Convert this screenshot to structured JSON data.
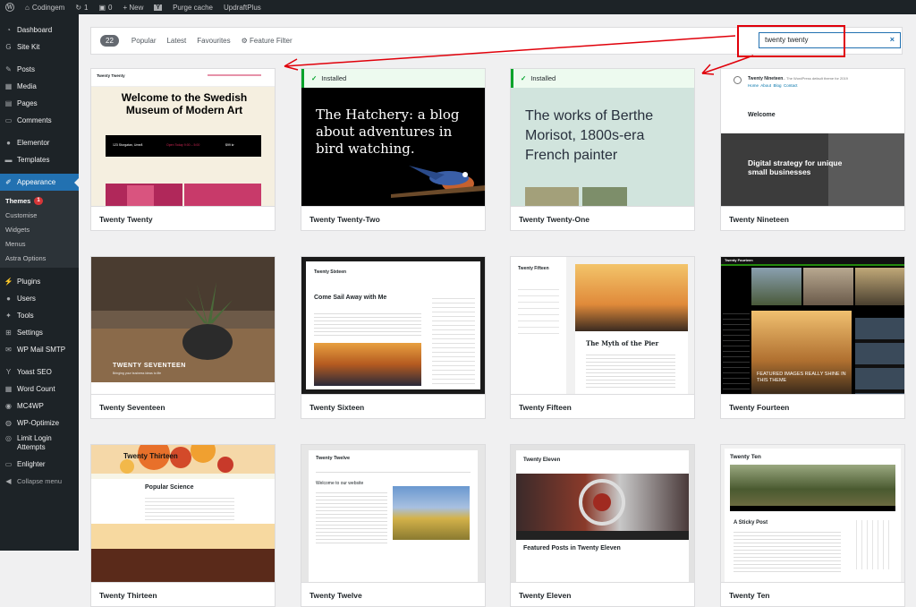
{
  "adminbar": {
    "site": "Codingem",
    "updates": "1",
    "comments": "0",
    "new": "+ New",
    "purge": "Purge cache",
    "updraft": "UpdraftPlus"
  },
  "sidebar": {
    "items": [
      {
        "label": "Dashboard",
        "icon": "gauge-icon"
      },
      {
        "label": "Site Kit",
        "icon": "sitekit-icon"
      },
      {
        "label": "Posts",
        "icon": "pin-icon"
      },
      {
        "label": "Media",
        "icon": "media-icon"
      },
      {
        "label": "Pages",
        "icon": "page-icon"
      },
      {
        "label": "Comments",
        "icon": "comment-icon"
      },
      {
        "label": "Elementor",
        "icon": "elementor-icon"
      },
      {
        "label": "Templates",
        "icon": "folder-icon"
      },
      {
        "label": "Appearance",
        "icon": "brush-icon"
      },
      {
        "label": "Plugins",
        "icon": "plug-icon"
      },
      {
        "label": "Users",
        "icon": "user-icon"
      },
      {
        "label": "Tools",
        "icon": "wrench-icon"
      },
      {
        "label": "Settings",
        "icon": "settings-icon"
      },
      {
        "label": "WP Mail SMTP",
        "icon": "mail-icon"
      },
      {
        "label": "Yoast SEO",
        "icon": "yoast-icon"
      },
      {
        "label": "Word Count",
        "icon": "count-icon"
      },
      {
        "label": "MC4WP",
        "icon": "mc4wp-icon"
      },
      {
        "label": "WP-Optimize",
        "icon": "optimize-icon"
      },
      {
        "label": "Limit Login Attempts",
        "icon": "lock-icon"
      },
      {
        "label": "Enlighter",
        "icon": "code-icon"
      },
      {
        "label": "Collapse menu",
        "icon": "collapse-icon"
      }
    ],
    "submenu": {
      "themes": "Themes",
      "themes_badge": "1",
      "customise": "Customise",
      "widgets": "Widgets",
      "menus": "Menus",
      "astra": "Astra Options"
    }
  },
  "filters": {
    "count": "22",
    "popular": "Popular",
    "latest": "Latest",
    "favourites": "Favourites",
    "feature_filter": "Feature Filter"
  },
  "search": {
    "value": "twenty twenty",
    "clear": "×"
  },
  "themes": [
    {
      "name": "Twenty Twenty",
      "installed": false
    },
    {
      "name": "Twenty Twenty-Two",
      "installed": true
    },
    {
      "name": "Twenty Twenty-One",
      "installed": true
    },
    {
      "name": "Twenty Nineteen",
      "installed": false
    },
    {
      "name": "Twenty Seventeen",
      "installed": false
    },
    {
      "name": "Twenty Sixteen",
      "installed": false
    },
    {
      "name": "Twenty Fifteen",
      "installed": false
    },
    {
      "name": "Twenty Fourteen",
      "installed": false
    },
    {
      "name": "Twenty Thirteen",
      "installed": false
    },
    {
      "name": "Twenty Twelve",
      "installed": false
    },
    {
      "name": "Twenty Eleven",
      "installed": false
    },
    {
      "name": "Twenty Ten",
      "installed": false
    }
  ],
  "installed_label": "Installed",
  "previews": {
    "tt_header": "Twenty Twenty",
    "tt_title": "Welcome to the Swedish Museum of Modern Art",
    "tt_address": "123 Storgatan, Umeå",
    "tt_hours": "Open Today 9:00 – 5:00",
    "tt_price": "$99 kr",
    "t22_text": "The Hatchery: a blog about adventures in bird watching.",
    "t21_text": "The works of Berthe Morisot, 1800s-era French painter",
    "t19_site": "Twenty Nineteen",
    "t19_tagline": "— The WordPress default theme for 2019",
    "t19_nav": "Home  About  Blog  Contact",
    "t19_welcome": "Welcome",
    "t19_hero": "Digital strategy for unique small businesses",
    "t17_title": "TWENTY SEVENTEEN",
    "t17_tagline": "Bringing your business ideas to life",
    "t16_site": "Twenty Sixteen",
    "t16_post": "Come Sail Away with Me",
    "t15_site": "Twenty Fifteen",
    "t15_post": "The Myth of the Pier",
    "t14_site": "Twenty Fourteen",
    "t14_feat": "FEATURED IMAGES REALLY SHINE IN THIS THEME",
    "t13_site": "Twenty Thirteen",
    "t13_post": "Popular Science",
    "t12_site": "Twenty Twelve",
    "t12_welcome": "Welcome to our website",
    "t11_site": "Twenty Eleven",
    "t11_featured": "Featured Posts in Twenty Eleven",
    "t10_site": "Twenty Ten",
    "t10_post": "A Sticky Post"
  }
}
